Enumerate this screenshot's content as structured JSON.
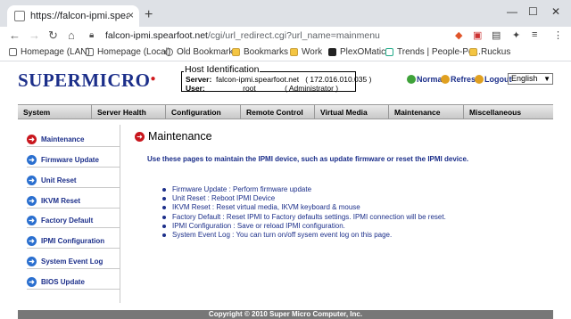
{
  "browser": {
    "tab_title": "https://falcon-ipmi.spearfoot.net",
    "new_tab": "+",
    "close": "×",
    "win_controls": [
      "—",
      "☐",
      "✕"
    ],
    "url_domain": "falcon-ipmi.spearfoot.net",
    "url_path": "/cgi/url_redirect.cgi?url_name=mainmenu",
    "bookmarks": [
      {
        "label": "Homepage (LAN)"
      },
      {
        "label": "Homepage (Local)"
      },
      {
        "label": "Old Bookmarks"
      },
      {
        "label": "Bookmarks"
      },
      {
        "label": "Work"
      },
      {
        "label": "PlexOMatic"
      },
      {
        "label": "Trends | People-Po..."
      },
      {
        "label": "Ruckus"
      }
    ]
  },
  "header": {
    "logo": "SUPERMICRO",
    "host_title": "Host Identification",
    "server_label": "Server:",
    "server_value": "falcon-ipmi.spearfoot.net",
    "server_ip": "( 172.016.010.035 )",
    "user_label": "User:",
    "user_value": "root",
    "user_role": "( Administrator )",
    "status_normal": "Normal",
    "refresh": "Refresh",
    "logout": "Logout",
    "language": "English"
  },
  "menu": [
    "System",
    "Server Health",
    "Configuration",
    "Remote Control",
    "Virtual Media",
    "Maintenance",
    "Miscellaneous"
  ],
  "sidebar": [
    {
      "label": "Maintenance",
      "active": true
    },
    {
      "label": "Firmware Update"
    },
    {
      "label": "Unit Reset"
    },
    {
      "label": "IKVM Reset"
    },
    {
      "label": "Factory Default"
    },
    {
      "label": "IPMI Configuration"
    },
    {
      "label": "System Event Log"
    },
    {
      "label": "BIOS Update"
    }
  ],
  "main": {
    "title": "Maintenance",
    "intro": "Use these pages to maintain the IPMI device, such as update firmware or reset the IPMI device.",
    "items": [
      "Firmware Update : Perform firmware update",
      "Unit Reset : Reboot IPMI Device",
      "IKVM Reset : Reset virtual media, IKVM keyboard & mouse",
      "Factory Default : Reset IPMI to Factory defaults settings. IPMI connection will be reset.",
      "IPMI Configuration : Save or reload IPMI configuration.",
      "System Event Log : You can turn on/off sysem event log on this page."
    ]
  },
  "footer": "Copyright © 2010 Super Micro Computer, Inc.",
  "colors": {
    "accent": "#1c2f8a",
    "red": "#c8161d",
    "blue_arrow": "#2a6fcf"
  }
}
